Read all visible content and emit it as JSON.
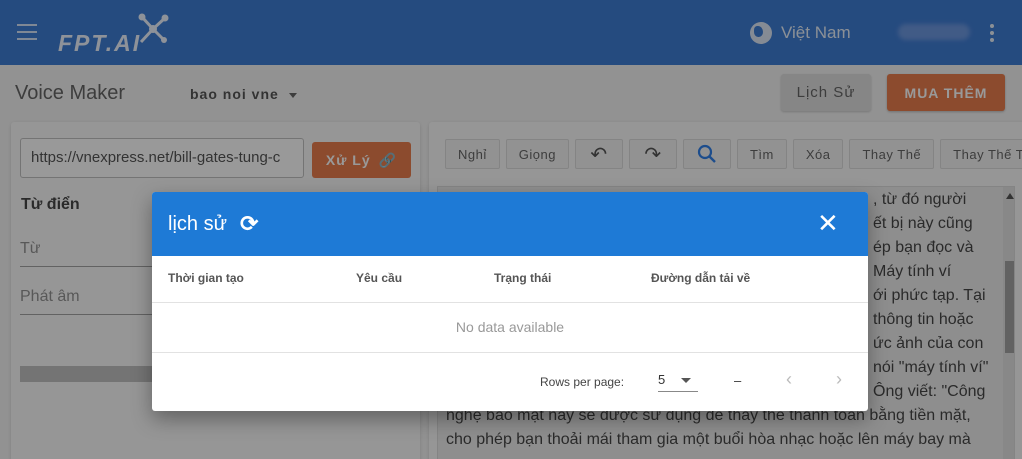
{
  "header": {
    "logo_text": "FPT.AI",
    "language": "Việt Nam"
  },
  "toolbar": {
    "page_title": "Voice Maker",
    "voice": "bao noi vne",
    "history_button": "Lịch Sử",
    "buy_button": "MUA THÊM"
  },
  "left": {
    "url_value": "https://vnexpress.net/bill-gates-tung-c",
    "process_button": "Xử Lý",
    "dictionary_title": "Từ điển",
    "word_placeholder": "Từ",
    "pron_placeholder": "Phát âm"
  },
  "editor": {
    "tools": [
      "Nghỉ",
      "Giọng",
      "Tìm",
      "Xóa",
      "Thay Thế",
      "Thay Thế Tất Cả"
    ],
    "lines_right": [
      ", từ đó người",
      "ết bị này cũng",
      "ép bạn đọc và",
      "Máy tính ví",
      "ới phức tạp. Tại",
      "thông tin hoặc",
      "ức ảnh của con",
      "nói \"máy tính ví\"",
      "Ông viết: \"Công"
    ],
    "lines_full": [
      "nghệ bảo mật này sẽ được sử dụng để thay thế thanh toán bằng tiền mặt,",
      "cho phép bạn thoải mái tham gia một buổi hòa nhạc hoặc lên máy bay mà"
    ]
  },
  "dialog": {
    "title": "lịch sử",
    "columns": [
      "Thời gian tạo",
      "Yêu cầu",
      "Trạng thái",
      "Đường dẫn tải về"
    ],
    "empty_text": "No data available",
    "rows_per_page_label": "Rows per page:",
    "rows_per_page_value": "5",
    "range_text": "–"
  }
}
